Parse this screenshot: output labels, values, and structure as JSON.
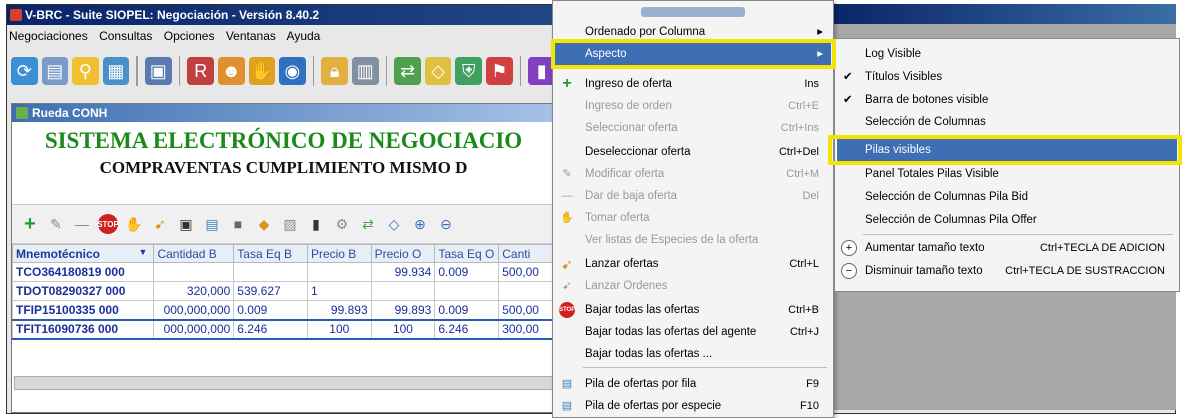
{
  "window": {
    "title": "V-BRC - Suite SIOPEL: Negociación - Versión 8.40.2"
  },
  "menubar": [
    "Negociaciones",
    "Consultas",
    "Opciones",
    "Ventanas",
    "Ayuda"
  ],
  "child": {
    "title": "Rueda CONH",
    "banner_line1": "SISTEMA ELECTRÓNICO DE NEGOCIACIO",
    "banner_line2": "COMPRAVENTAS CUMPLIMIENTO MISMO D"
  },
  "table": {
    "columns": [
      "Mnemotécnico",
      "Cantidad B",
      "Tasa Eq B",
      "Precio B",
      "Precio O",
      "Tasa Eq O",
      "Canti"
    ],
    "rows": [
      [
        "TCO364180819 000",
        "",
        "",
        "",
        "99.934",
        "0.009",
        "500,00"
      ],
      [
        "TDOT08290327 000",
        "320,000",
        "539.627",
        "1",
        "",
        "",
        ""
      ],
      [
        "TFIP15100335 000",
        "000,000,000",
        "0.009",
        "99.893",
        "99.893",
        "0.009",
        "500,00"
      ],
      [
        "TFIT16090736 000",
        "000,000,000",
        "6.246",
        "100",
        "100",
        "6.246",
        "300,00"
      ]
    ]
  },
  "menu": {
    "items": [
      {
        "label": "Ordenado por Columna",
        "key": ""
      },
      {
        "label": "Aspecto",
        "key": ""
      },
      {
        "label": "Ingreso de oferta",
        "key": "Ins"
      },
      {
        "label": "Ingreso de orden",
        "key": "Ctrl+E"
      },
      {
        "label": "Seleccionar oferta",
        "key": "Ctrl+Ins"
      },
      {
        "label": "Deseleccionar oferta",
        "key": "Ctrl+Del"
      },
      {
        "label": "Modificar oferta",
        "key": "Ctrl+M"
      },
      {
        "label": "Dar de baja oferta",
        "key": "Del"
      },
      {
        "label": "Tomar oferta",
        "key": ""
      },
      {
        "label": "Ver listas de Especies de la oferta",
        "key": ""
      },
      {
        "label": "Lanzar ofertas",
        "key": "Ctrl+L"
      },
      {
        "label": "Lanzar Ordenes",
        "key": ""
      },
      {
        "label": "Bajar todas las ofertas",
        "key": "Ctrl+B"
      },
      {
        "label": "Bajar todas las ofertas del agente",
        "key": "Ctrl+J"
      },
      {
        "label": "Bajar todas las ofertas ...",
        "key": ""
      },
      {
        "label": "Pila de ofertas por fila",
        "key": "F9"
      },
      {
        "label": "Pila de ofertas por especie",
        "key": "F10"
      }
    ]
  },
  "submenu": {
    "items": [
      {
        "label": "Log Visible",
        "key": ""
      },
      {
        "label": "Títulos Visibles",
        "key": ""
      },
      {
        "label": "Barra de botones visible",
        "key": ""
      },
      {
        "label": "Selección de Columnas",
        "key": ""
      },
      {
        "label": "Pilas visibles",
        "key": ""
      },
      {
        "label": "Panel Totales Pilas Visible",
        "key": ""
      },
      {
        "label": "Selección de Columnas Pila Bid",
        "key": ""
      },
      {
        "label": "Selección de Columnas Pila Offer",
        "key": ""
      },
      {
        "label": "Aumentar tamaño texto",
        "key": "Ctrl+TECLA DE ADICION"
      },
      {
        "label": "Disminuir tamaño texto",
        "key": "Ctrl+TECLA DE SUSTRACCION"
      }
    ]
  }
}
